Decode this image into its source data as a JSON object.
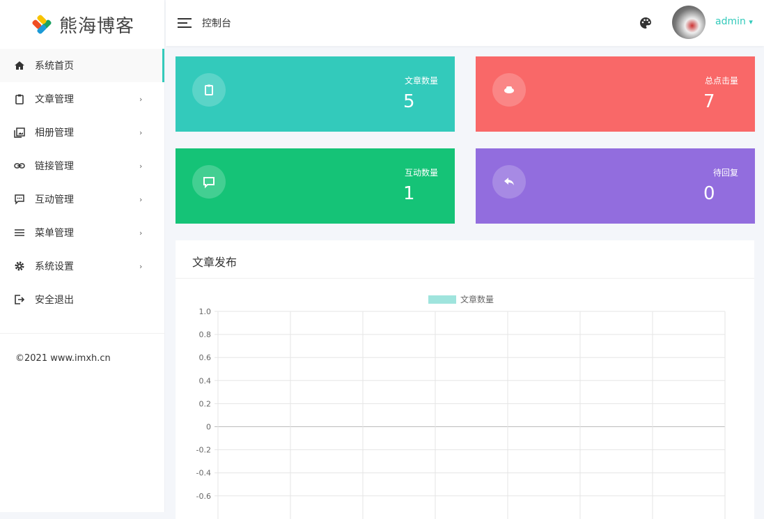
{
  "sidebar": {
    "logo": "熊海博客",
    "items": [
      {
        "label": "系统首页",
        "icon": "home-icon",
        "active": true,
        "chevron": false
      },
      {
        "label": "文章管理",
        "icon": "clipboard-icon",
        "chevron": true
      },
      {
        "label": "相册管理",
        "icon": "image-icon",
        "chevron": true
      },
      {
        "label": "链接管理",
        "icon": "link-icon",
        "chevron": true
      },
      {
        "label": "互动管理",
        "icon": "comment-icon",
        "chevron": true
      },
      {
        "label": "菜单管理",
        "icon": "menu-icon",
        "chevron": true
      },
      {
        "label": "系统设置",
        "icon": "gear-icon",
        "chevron": true
      },
      {
        "label": "安全退出",
        "icon": "logout-icon",
        "chevron": false
      }
    ],
    "chevron": "›",
    "footer": "©2021 www.imxh.cn"
  },
  "header": {
    "title": "控制台",
    "user": "admin",
    "caret": "▾"
  },
  "cards": [
    {
      "label": "文章数量",
      "value": "5",
      "color": "#33cabb"
    },
    {
      "label": "总点击量",
      "value": "7",
      "color": "#f96868"
    },
    {
      "label": "互动数量",
      "value": "1",
      "color": "#15c377"
    },
    {
      "label": "待回复",
      "value": "0",
      "color": "#926dde"
    }
  ],
  "panel": {
    "title": "文章发布"
  },
  "chart_data": {
    "type": "line",
    "title": "",
    "legend": [
      "文章数量"
    ],
    "legend_position": "top",
    "legend_color": "#9fe4dd",
    "series": [
      {
        "name": "文章数量",
        "values": []
      }
    ],
    "yticks": [
      "1.0",
      "0.8",
      "0.6",
      "0.4",
      "0.2",
      "0",
      "-0.2",
      "-0.4",
      "-0.6"
    ],
    "ylim": [
      -1,
      1
    ],
    "x_categories_count": 7,
    "grid": true
  }
}
